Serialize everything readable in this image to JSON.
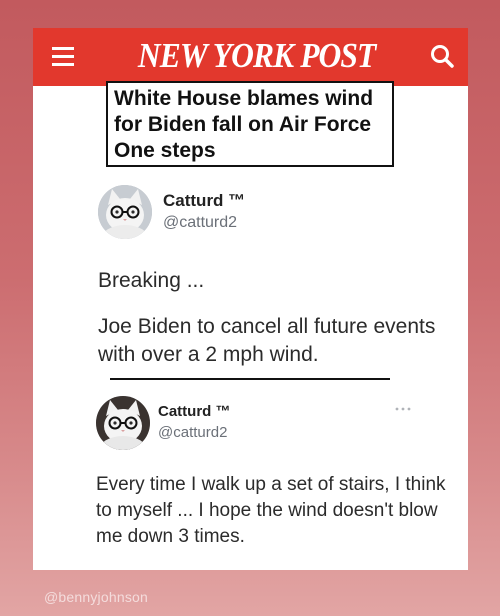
{
  "header": {
    "logo": "NEW YORK POST",
    "menu_icon": "hamburger-menu-icon",
    "search_icon": "search-icon"
  },
  "headline": {
    "text": "White House blames wind for Biden fall on Air Force One steps"
  },
  "tweet1": {
    "name": "Catturd ™",
    "handle": "@catturd2",
    "breaking": "Breaking ...",
    "body": "Joe Biden to cancel all future events with over a 2 mph wind."
  },
  "tweet2": {
    "name": "Catturd ™",
    "handle": "@catturd2",
    "body": "Every time I walk up a set of stairs, I think to myself ... I hope the wind doesn't blow me down 3 times."
  },
  "watermark": "@bennyjohnson",
  "colors": {
    "brand_red": "#e2382d",
    "background_top": "#c25a5e",
    "background_bottom": "#e2a5a4"
  }
}
